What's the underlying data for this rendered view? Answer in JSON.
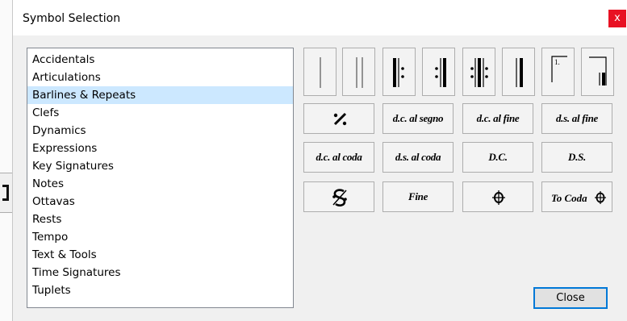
{
  "dialog": {
    "title": "Symbol Selection",
    "close_x": "x",
    "close_button": "Close"
  },
  "categories": [
    "Accidentals",
    "Articulations",
    "Barlines & Repeats",
    "Clefs",
    "Dynamics",
    "Expressions",
    "Key Signatures",
    "Notes",
    "Ottavas",
    "Rests",
    "Tempo",
    "Text & Tools",
    "Time Signatures",
    "Tuplets"
  ],
  "selected_category": "Barlines & Repeats",
  "symbols": {
    "single_barline": "single-barline-icon",
    "double_barline": "double-barline-icon",
    "repeat_start": "repeat-start-icon",
    "repeat_end": "repeat-end-icon",
    "repeat_both": "repeat-both-icon",
    "final_barline": "final-barline-icon",
    "first_ending": "first-ending-icon",
    "second_ending": "second-ending-icon",
    "measure_repeat": "measure-repeat-icon",
    "dc_al_segno": "d.c. al segno",
    "dc_al_fine": "d.c. al fine",
    "ds_al_fine": "d.s. al fine",
    "dc_al_coda": "d.c. al coda",
    "ds_al_coda": "d.s. al coda",
    "dc": "D.C.",
    "ds": "D.S.",
    "segno": "segno-icon",
    "fine": "Fine",
    "coda": "coda-icon",
    "to_coda": "To Coda",
    "first_ending_label": "1."
  },
  "colors": {
    "selection": "#cce8ff",
    "close_x_bg": "#e81123",
    "button_focus": "#0078d7"
  }
}
